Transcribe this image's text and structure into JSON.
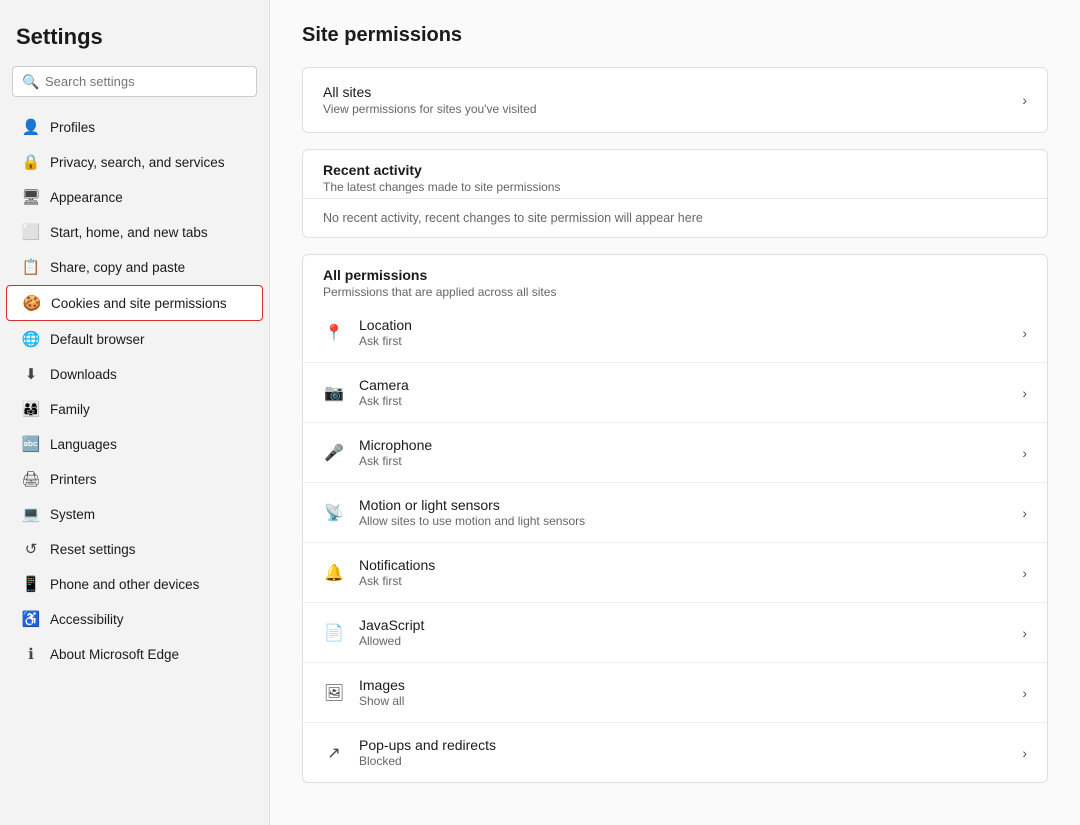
{
  "sidebar": {
    "title": "Settings",
    "search_placeholder": "Search settings",
    "items": [
      {
        "id": "profiles",
        "label": "Profiles",
        "icon": "👤",
        "active": false
      },
      {
        "id": "privacy",
        "label": "Privacy, search, and services",
        "icon": "🔒",
        "active": false
      },
      {
        "id": "appearance",
        "label": "Appearance",
        "icon": "🖥",
        "active": false
      },
      {
        "id": "start-home",
        "label": "Start, home, and new tabs",
        "icon": "⬜",
        "active": false
      },
      {
        "id": "share-copy",
        "label": "Share, copy and paste",
        "icon": "📋",
        "active": false
      },
      {
        "id": "cookies",
        "label": "Cookies and site permissions",
        "icon": "🍪",
        "active": true
      },
      {
        "id": "default-browser",
        "label": "Default browser",
        "icon": "🌐",
        "active": false
      },
      {
        "id": "downloads",
        "label": "Downloads",
        "icon": "⬇",
        "active": false
      },
      {
        "id": "family",
        "label": "Family",
        "icon": "👨‍👩‍👧",
        "active": false
      },
      {
        "id": "languages",
        "label": "Languages",
        "icon": "🔤",
        "active": false
      },
      {
        "id": "printers",
        "label": "Printers",
        "icon": "🖨",
        "active": false
      },
      {
        "id": "system",
        "label": "System",
        "icon": "💻",
        "active": false
      },
      {
        "id": "reset",
        "label": "Reset settings",
        "icon": "↺",
        "active": false
      },
      {
        "id": "phone",
        "label": "Phone and other devices",
        "icon": "📱",
        "active": false
      },
      {
        "id": "accessibility",
        "label": "Accessibility",
        "icon": "♿",
        "active": false
      },
      {
        "id": "about",
        "label": "About Microsoft Edge",
        "icon": "ℹ",
        "active": false
      }
    ]
  },
  "main": {
    "page_title": "Site permissions",
    "all_sites": {
      "title": "All sites",
      "subtitle": "View permissions for sites you've visited"
    },
    "recent_activity": {
      "title": "Recent activity",
      "subtitle": "The latest changes made to site permissions",
      "empty_message": "No recent activity, recent changes to site permission will appear here"
    },
    "all_permissions": {
      "title": "All permissions",
      "subtitle": "Permissions that are applied across all sites",
      "items": [
        {
          "id": "location",
          "title": "Location",
          "subtitle": "Ask first",
          "icon": "📍"
        },
        {
          "id": "camera",
          "title": "Camera",
          "subtitle": "Ask first",
          "icon": "📷"
        },
        {
          "id": "microphone",
          "title": "Microphone",
          "subtitle": "Ask first",
          "icon": "🎤"
        },
        {
          "id": "motion-sensors",
          "title": "Motion or light sensors",
          "subtitle": "Allow sites to use motion and light sensors",
          "icon": "📡"
        },
        {
          "id": "notifications",
          "title": "Notifications",
          "subtitle": "Ask first",
          "icon": "🔔"
        },
        {
          "id": "javascript",
          "title": "JavaScript",
          "subtitle": "Allowed",
          "icon": "📄"
        },
        {
          "id": "images",
          "title": "Images",
          "subtitle": "Show all",
          "icon": "🖼"
        },
        {
          "id": "popups",
          "title": "Pop-ups and redirects",
          "subtitle": "Blocked",
          "icon": "↗"
        }
      ]
    }
  }
}
